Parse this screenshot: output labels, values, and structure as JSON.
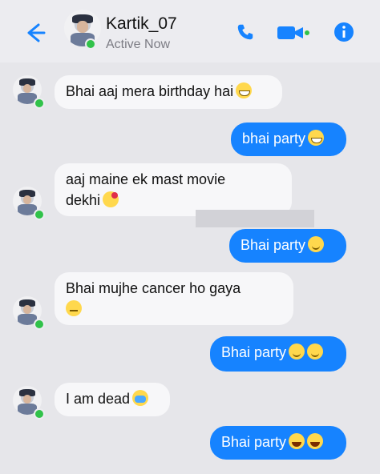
{
  "header": {
    "name": "Kartik_07",
    "status": "Active Now"
  },
  "colors": {
    "accent": "#1683ff",
    "online": "#31c24a",
    "incoming_bubble": "#f7f7f9"
  },
  "messages": [
    {
      "direction": "incoming",
      "text": "Bhai aaj mera birthday hai",
      "emoji": "grinning-face-emoji"
    },
    {
      "direction": "outgoing",
      "text": "bhai party",
      "emoji": "grinning-face-emoji"
    },
    {
      "direction": "incoming",
      "text_line1": "aaj maine ek mast movie",
      "text_line2": "dekhi",
      "emoji": "smiling-face-with-hearts-emoji"
    },
    {
      "direction": "outgoing",
      "text": "Bhai party",
      "emoji": "winking-face-emoji"
    },
    {
      "direction": "incoming",
      "text": "Bhai mujhe cancer ho gaya",
      "emoji": "expressionless-face-emoji"
    },
    {
      "direction": "outgoing",
      "text": "Bhai party",
      "emoji": "smiling-face-emoji x2"
    },
    {
      "direction": "incoming",
      "text": "I am dead",
      "emoji": "crying-face-emoji"
    },
    {
      "direction": "outgoing",
      "text": "Bhai party",
      "emoji": "laughing-face-emoji x2"
    }
  ],
  "icons": {
    "back": "back-arrow-icon",
    "call": "phone-icon",
    "video": "video-camera-icon",
    "info": "info-icon"
  }
}
